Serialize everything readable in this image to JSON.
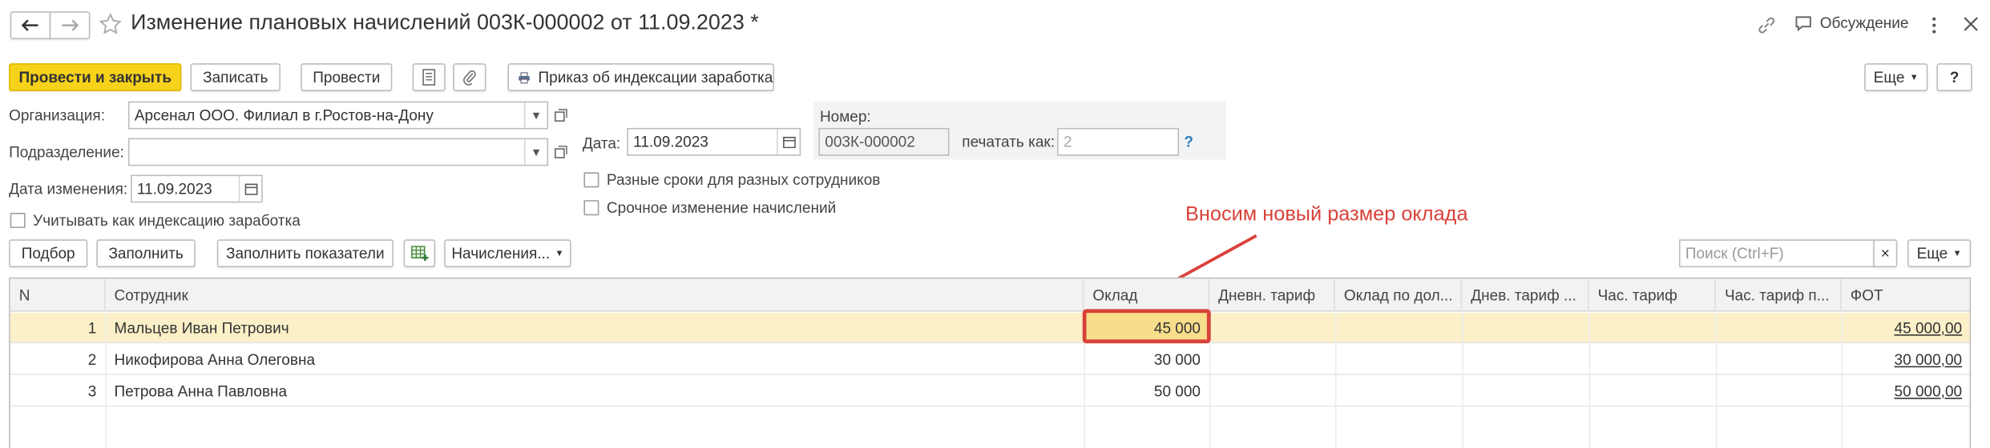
{
  "header": {
    "title": "Изменение плановых начислений 003К-000002 от 11.09.2023 *",
    "discussion_label": "Обсуждение"
  },
  "toolbar": {
    "post_close": "Провести и закрыть",
    "save": "Записать",
    "post": "Провести",
    "print_order": "Приказ об индексации заработка",
    "more": "Еще",
    "help": "?"
  },
  "form": {
    "org_label": "Организация:",
    "org_value": "Арсенал ООО. Филиал в г.Ростов-на-Дону",
    "dept_label": "Подразделение:",
    "dept_value": "",
    "change_date_label": "Дата изменения:",
    "change_date_value": "11.09.2023",
    "date_label": "Дата:",
    "date_value": "11.09.2023",
    "number_label": "Номер:",
    "number_value": "003К-000002",
    "print_as_label": "печатать как:",
    "print_as_value": "2",
    "print_as_help": "?",
    "cb_index": "Учитывать как индексацию заработка",
    "cb_diff_terms": "Разные сроки для разных сотрудников",
    "cb_urgent": "Срочное изменение начислений"
  },
  "annotation": "Вносим новый размер оклада",
  "table_toolbar": {
    "pick": "Подбор",
    "fill": "Заполнить",
    "fill_indicators": "Заполнить показатели",
    "accruals": "Начисления...",
    "search_placeholder": "Поиск (Ctrl+F)",
    "clear": "×",
    "more": "Еще"
  },
  "table": {
    "columns": [
      "N",
      "Сотрудник",
      "Оклад",
      "Дневн. тариф",
      "Оклад по дол...",
      "Днев. тариф ...",
      "Час. тариф",
      "Час. тариф п...",
      "ФОТ"
    ],
    "rows": [
      {
        "n": "1",
        "employee": "Мальцев Иван Петрович",
        "salary": "45 000",
        "fot": "45 000,00"
      },
      {
        "n": "2",
        "employee": "Никофирова Анна Олеговна",
        "salary": "30 000",
        "fot": "30 000,00"
      },
      {
        "n": "3",
        "employee": "Петрова Анна Павловна",
        "salary": "50 000",
        "fot": "50 000,00"
      }
    ]
  },
  "colors": {
    "primary": "#f7d21a",
    "annotation": "#d9413a",
    "selected_row": "#fbf0c8"
  }
}
